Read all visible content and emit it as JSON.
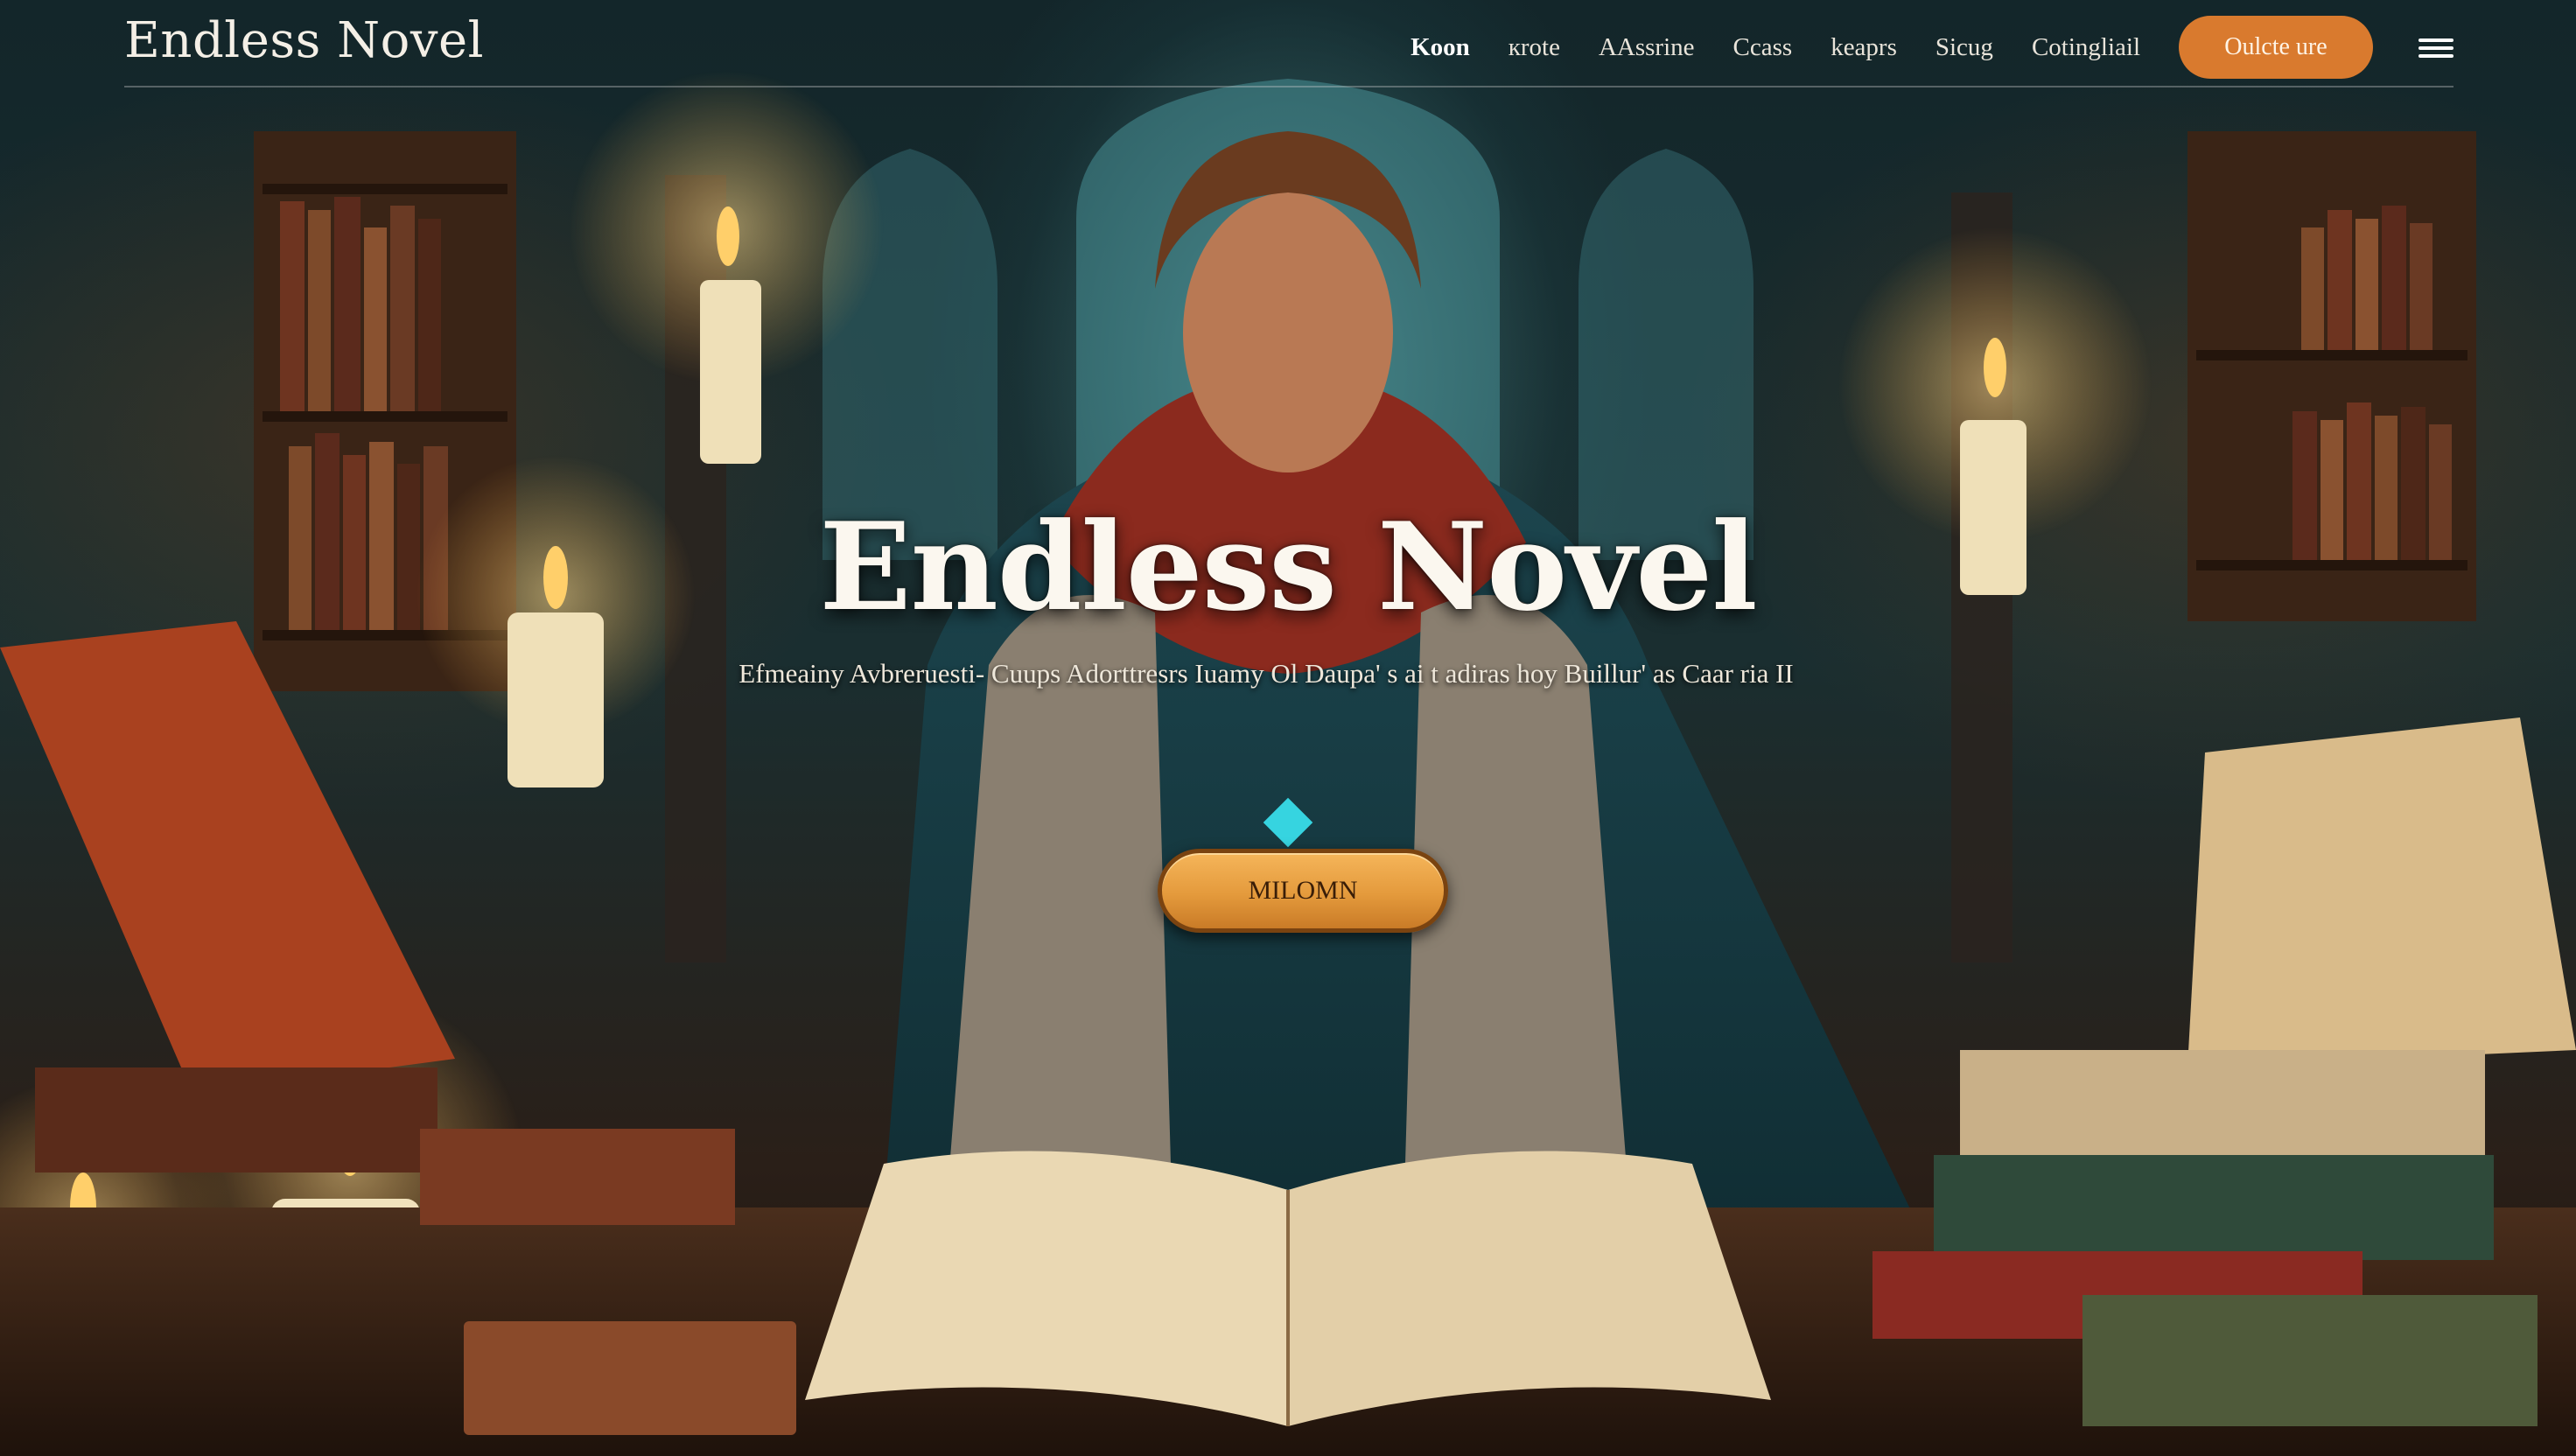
{
  "header": {
    "brand": "Endless Novel",
    "nav": [
      {
        "label": "Koon",
        "active": true
      },
      {
        "label": "кrote",
        "active": false
      },
      {
        "label": "AAssrine",
        "active": false
      },
      {
        "label": "Ccass",
        "active": false
      },
      {
        "label": "keaprs",
        "active": false
      },
      {
        "label": "Sicug",
        "active": false
      },
      {
        "label": "Cotingliail",
        "active": false
      }
    ],
    "cta_label": "Oulcte ure",
    "menu_icon": "hamburger-menu-icon"
  },
  "hero": {
    "title": "Endless Novel",
    "subtitle": "Efmeainy Avbreruesti- Cuups Adorttresrs  Iuamy Ol Daupa' s ai t adiras hoy Buillur' as Caar ria II",
    "button_label": "MILOMN"
  },
  "colors": {
    "accent_orange": "#d97a2e",
    "hero_button": "#e49a3c",
    "text_light": "#f4efe6"
  }
}
